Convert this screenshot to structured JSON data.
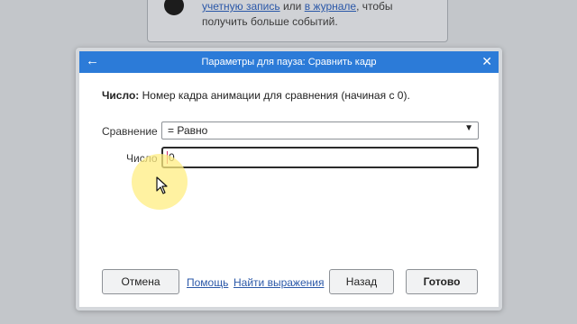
{
  "background_notice": {
    "line1_link1": "учетную запись",
    "line1_mid": " или ",
    "line1_link2": "в журнале",
    "line1_end": ", чтобы",
    "line2": "получить больше событий."
  },
  "dialog": {
    "title": "Параметры для пауза: Сравнить кадр",
    "back_icon": "arrow-left-icon",
    "close_icon": "close-icon",
    "description_bold": "Число:",
    "description_text": " Номер кадра анимации для сравнения (начиная с 0).",
    "comparison": {
      "label": "Сравнение",
      "selected": "= Равно"
    },
    "number": {
      "label": "Число",
      "value": "0"
    },
    "buttons": {
      "cancel": "Отмена",
      "help": "Помощь",
      "find_expressions": "Найти выражения",
      "back": "Назад",
      "done": "Готово"
    }
  },
  "colors": {
    "titlebar": "#2c7bd8",
    "link": "#2b58a8",
    "highlight": "#ffee82"
  }
}
